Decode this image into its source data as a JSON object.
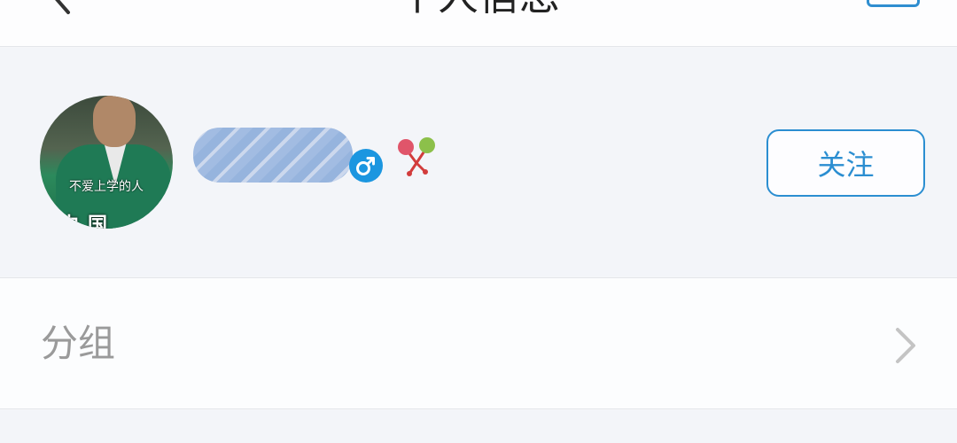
{
  "header": {
    "title": "个人信息",
    "back_icon": "chevron-left-icon",
    "right_icon": "menu-icon"
  },
  "profile": {
    "avatar_caption": "不爱上学的人",
    "avatar_caption2": "中国",
    "gender_icon": "male-icon",
    "gender_symbol": "♂",
    "badge_icon": "level-badge-icon",
    "follow_label": "关注",
    "accent_color": "#2b8ed1"
  },
  "group_row": {
    "label": "分组",
    "icon": "chevron-right-icon"
  }
}
